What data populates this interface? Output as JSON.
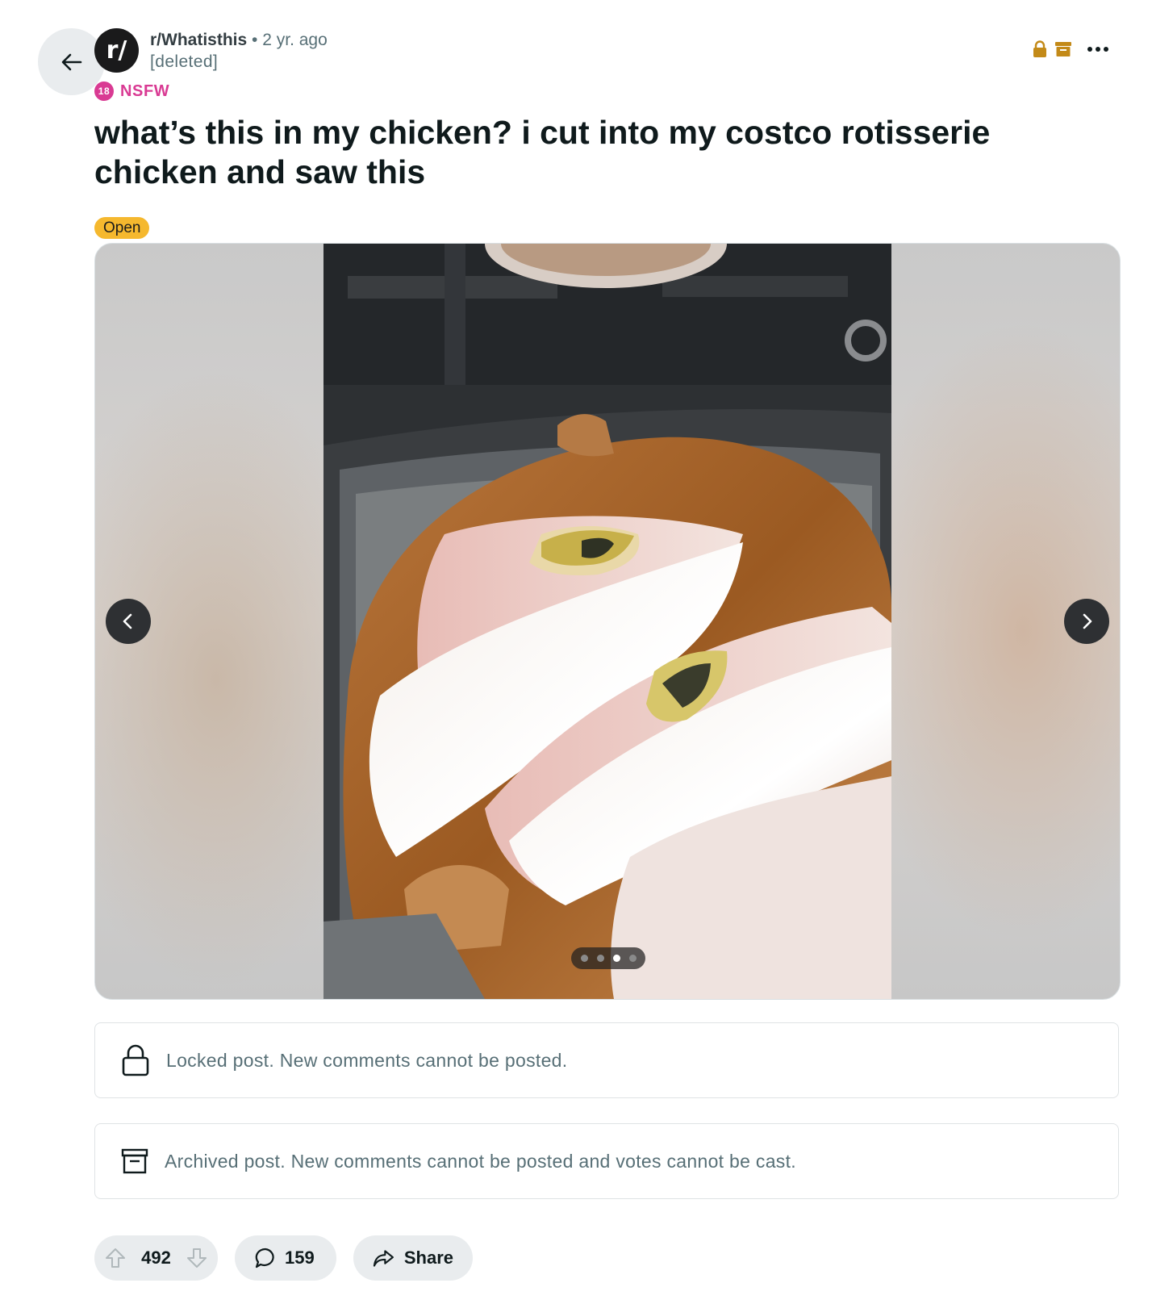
{
  "header": {
    "subreddit": "r/Whatisthis",
    "separator": "•",
    "time": "2 yr. ago",
    "author": "[deleted]",
    "avatar_text": "r/"
  },
  "badges": {
    "nsfw_age": "18",
    "nsfw_label": "NSFW"
  },
  "post": {
    "title": "what’s this in my chicken? i cut into my costco rotisserie chicken and saw this",
    "flair": "Open",
    "gallery": {
      "current_index": 3,
      "total": 4
    }
  },
  "notices": {
    "locked": "Locked post. New comments cannot be posted.",
    "archived": "Archived post. New comments cannot be posted and votes cannot be cast."
  },
  "actions": {
    "score": "492",
    "comments": "159",
    "share": "Share"
  },
  "colors": {
    "nsfw": "#d93a93",
    "flair": "#f5b82e",
    "status_icons": "#c38a18",
    "action_bg": "#e9ecee"
  },
  "icons": [
    "back-arrow-icon",
    "lock-icon",
    "archive-icon",
    "more-icon",
    "chevron-left-icon",
    "chevron-right-icon",
    "upvote-icon",
    "downvote-icon",
    "comment-icon",
    "share-icon"
  ]
}
